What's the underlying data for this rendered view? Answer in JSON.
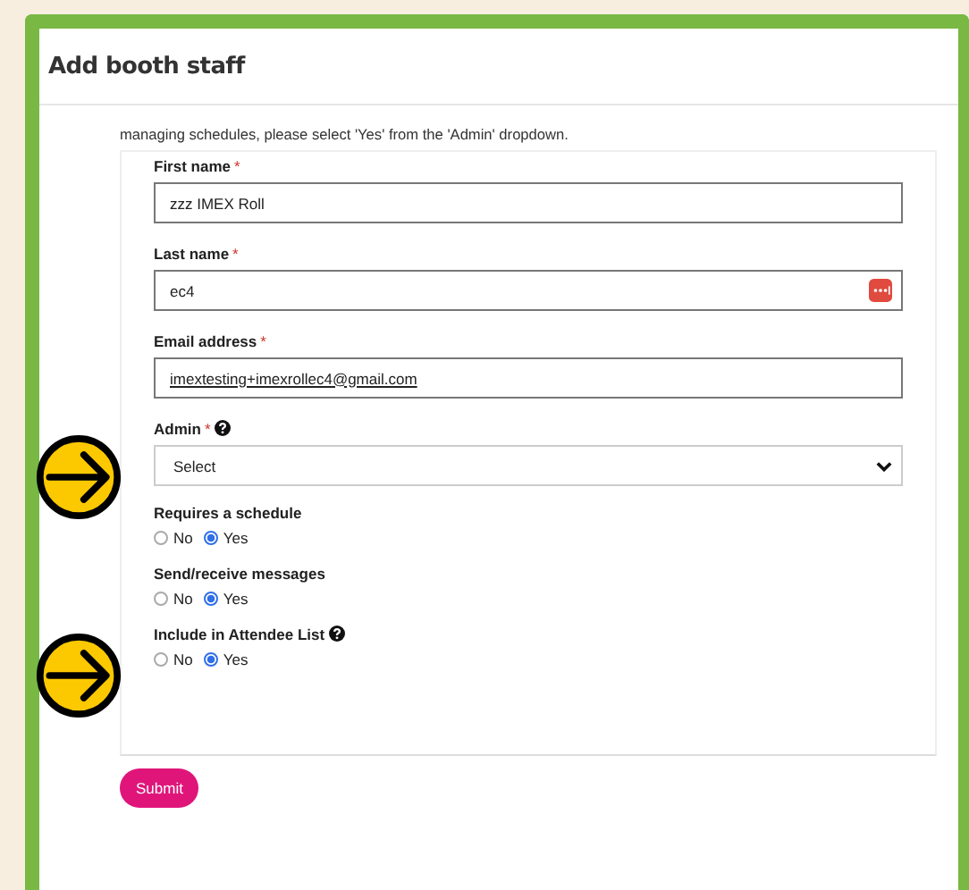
{
  "dialog": {
    "title": "Add booth staff"
  },
  "intro": "managing schedules, please select 'Yes' from the 'Admin' dropdown.",
  "fields": [
    {
      "kind": "text",
      "label": "First name",
      "required_mark": "*",
      "value": "zzz IMEX Roll"
    },
    {
      "kind": "text",
      "label": "Last name",
      "required_mark": "*",
      "value": "ec4",
      "autofill_icon": true
    },
    {
      "kind": "email",
      "label": "Email address",
      "required_mark": "*",
      "value": "imextesting+imexrollec4@gmail.com"
    },
    {
      "kind": "select",
      "label": "Admin",
      "required_mark": "*",
      "help": true,
      "annotated": true,
      "value": "Select"
    },
    {
      "kind": "radio",
      "label": "Requires a schedule",
      "options": [
        {
          "label": "No",
          "selected": false
        },
        {
          "label": "Yes",
          "selected": true
        }
      ]
    },
    {
      "kind": "radio",
      "label": "Send/receive messages",
      "options": [
        {
          "label": "No",
          "selected": false
        },
        {
          "label": "Yes",
          "selected": true
        }
      ]
    },
    {
      "kind": "radio",
      "label": "Include in Attendee List",
      "help": true,
      "annotated": true,
      "options": [
        {
          "label": "No",
          "selected": false
        },
        {
          "label": "Yes",
          "selected": true
        }
      ]
    }
  ],
  "submit": "Submit"
}
